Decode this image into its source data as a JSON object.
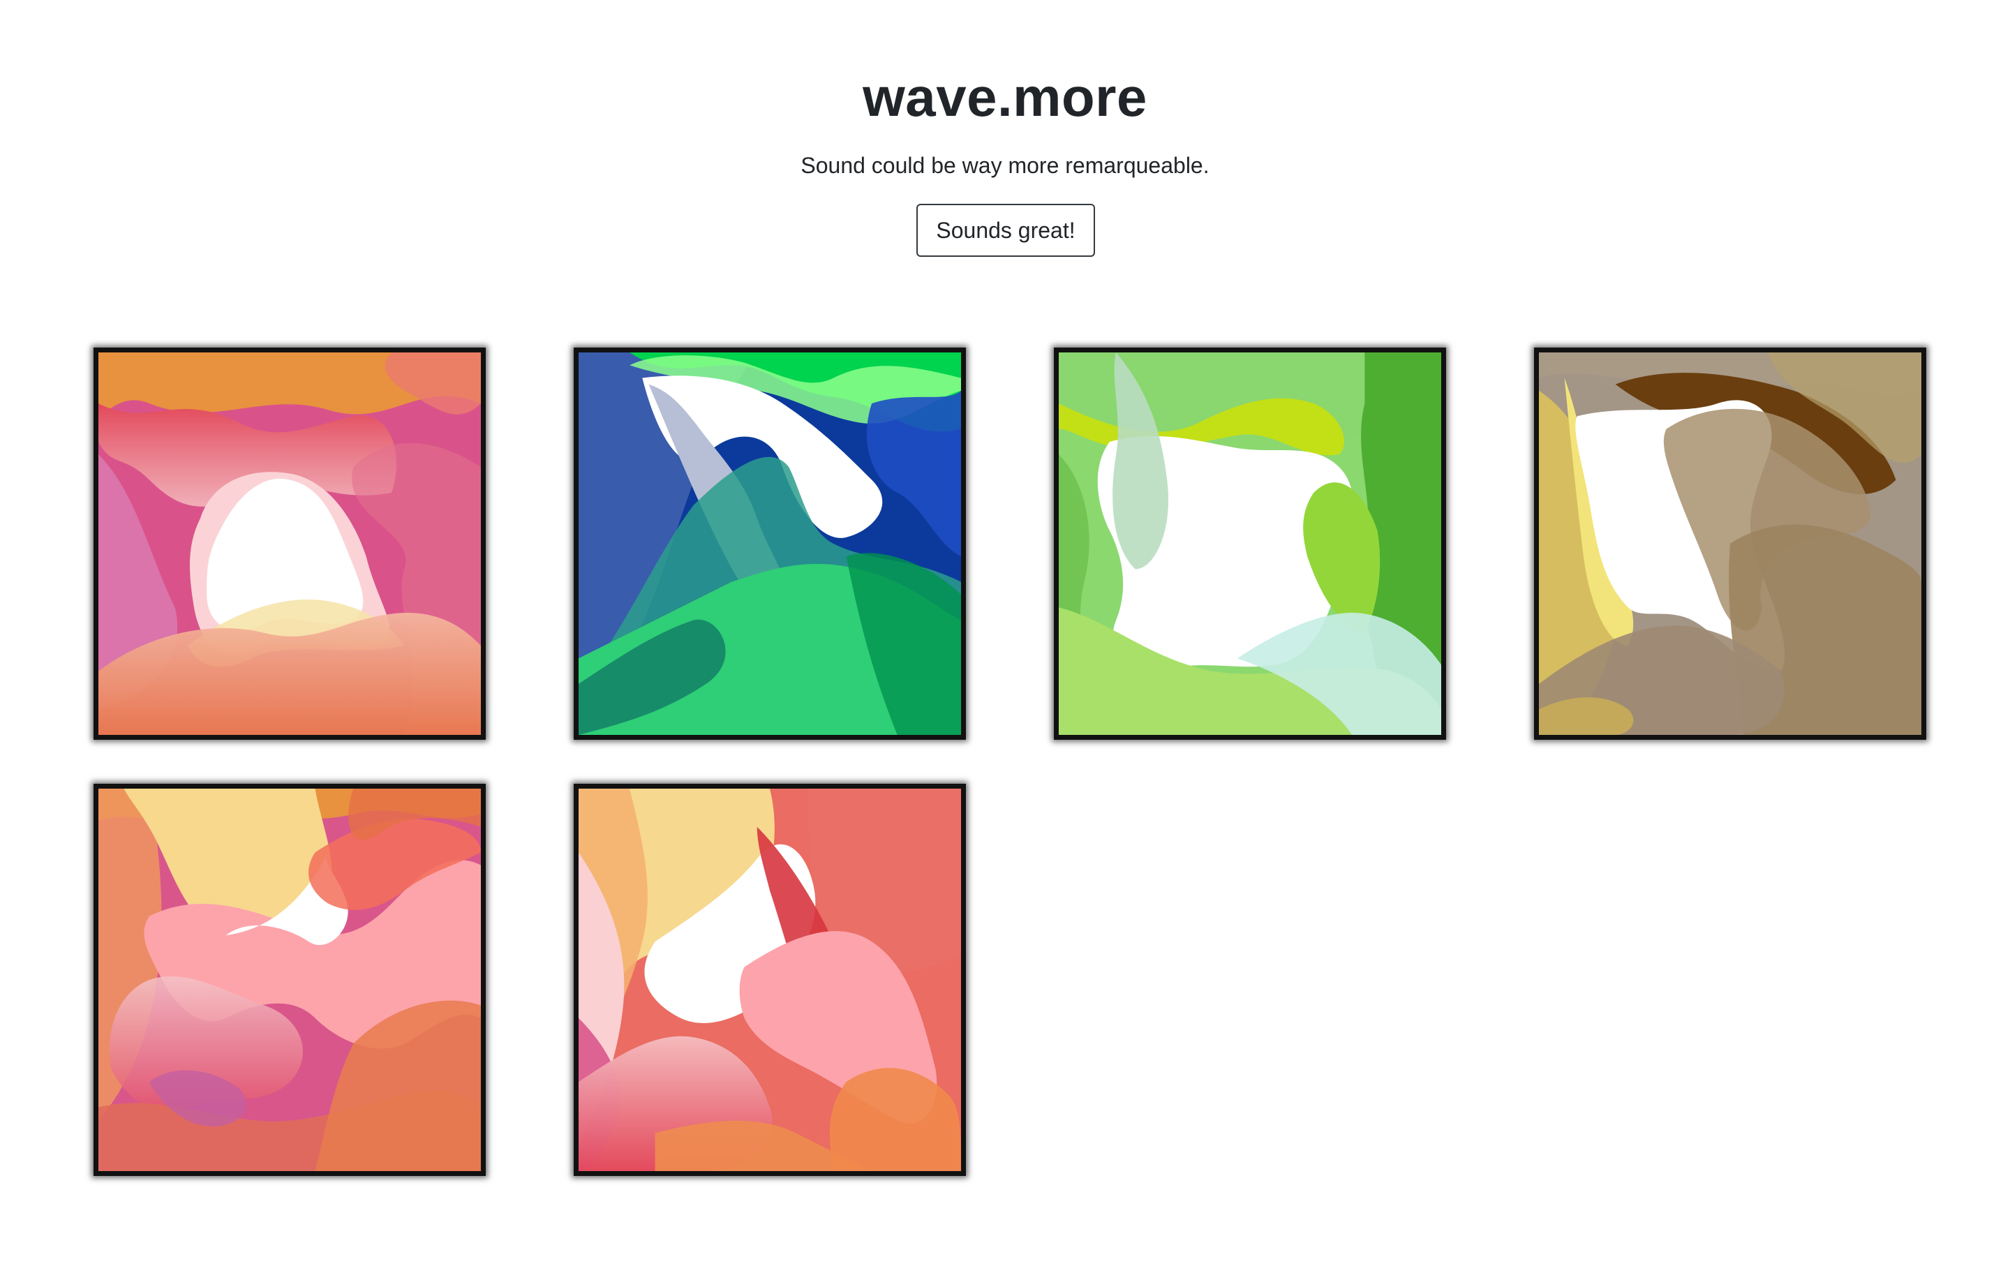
{
  "header": {
    "title": "wave.more",
    "subtitle": "Sound could be way more remarqueable.",
    "button_label": "Sounds great!"
  },
  "gallery": {
    "tiles": [
      {
        "name": "wave-tile-pink-orange",
        "palette": [
          "#e8913f",
          "#d9538a",
          "#e36f5e",
          "#f1c7c7",
          "#f6e3a6"
        ]
      },
      {
        "name": "wave-tile-blue-green",
        "palette": [
          "#00d34e",
          "#0b3a9c",
          "#2c9e8c",
          "#2ecf76",
          "#8cff8c"
        ]
      },
      {
        "name": "wave-tile-lime-green",
        "palette": [
          "#8bd86f",
          "#4dae32",
          "#c3e016",
          "#a8e06a",
          "#c6ede6"
        ]
      },
      {
        "name": "wave-tile-brown-gold",
        "palette": [
          "#a39686",
          "#6a3e0f",
          "#d6bd5f",
          "#f2e47a",
          "#9c8460"
        ]
      },
      {
        "name": "wave-tile-coral-yellow",
        "palette": [
          "#f7d88d",
          "#ee9560",
          "#fda4ab",
          "#d9568b",
          "#e06b5a"
        ]
      },
      {
        "name": "wave-tile-red-peach",
        "palette": [
          "#f7d88f",
          "#ea6c62",
          "#fda3ac",
          "#d9578c",
          "#e9864d"
        ]
      }
    ]
  }
}
